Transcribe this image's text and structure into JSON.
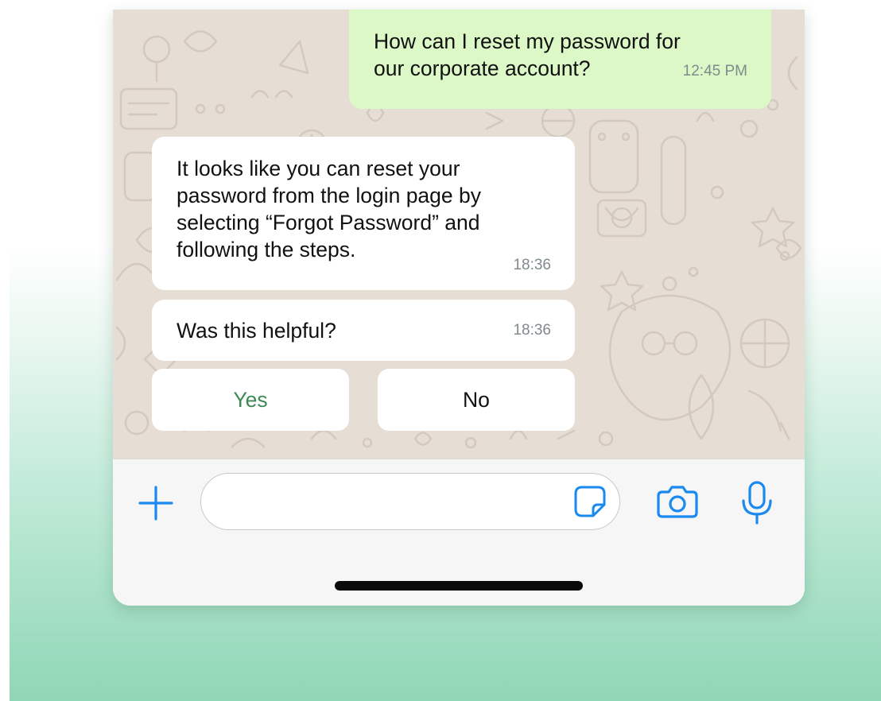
{
  "colors": {
    "accent": "#1b8af0",
    "outgoing_bubble": "#dcf8c6",
    "incoming_bubble": "#ffffff",
    "chat_background": "#e6ddd4",
    "quick_reply_yes": "#3e8a55",
    "timestamp": "#7f8a8f"
  },
  "messages": [
    {
      "direction": "outgoing",
      "lines": [
        "How can I reset my password for",
        "our corporate account?"
      ],
      "time": "12:45 PM"
    },
    {
      "direction": "incoming",
      "lines": [
        "It looks like you can reset your",
        "password from the login page by",
        "selecting “Forgot Password” and",
        "following the steps."
      ],
      "time": "18:36"
    },
    {
      "direction": "incoming",
      "lines": [
        "Was this helpful?"
      ],
      "time": "18:36"
    }
  ],
  "quick_replies": [
    {
      "label": "Yes"
    },
    {
      "label": "No"
    }
  ],
  "composer": {
    "icons": [
      "plus-icon",
      "sticker-icon",
      "camera-icon",
      "microphone-icon"
    ],
    "input_value": ""
  }
}
